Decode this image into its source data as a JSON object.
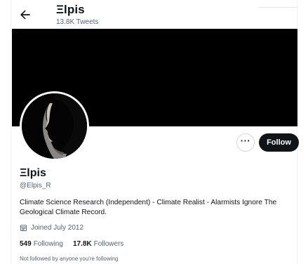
{
  "header": {
    "name": "Ξlpis",
    "tweet_count": "13.8K Tweets"
  },
  "actions": {
    "more_label": "···",
    "follow_label": "Follow"
  },
  "profile": {
    "display_name": "Ξlpis",
    "handle": "@Elpis_R",
    "bio": "Climate Science Research (Independent) - Climate Realist - Alarmists Ignore The Geological Climate Record.",
    "joined": "Joined July 2012",
    "following_count": "549",
    "following_label": "Following",
    "followers_count": "17.8K",
    "followers_label": "Followers",
    "not_followed_text": "Not followed by anyone you're following"
  },
  "icons": {
    "back": "arrow-left-icon",
    "calendar": "calendar-icon",
    "more": "more-icon"
  },
  "colors": {
    "text_primary": "#0f1419",
    "text_secondary": "#536471",
    "banner": "#000000",
    "follow_button": "#0f1419"
  }
}
